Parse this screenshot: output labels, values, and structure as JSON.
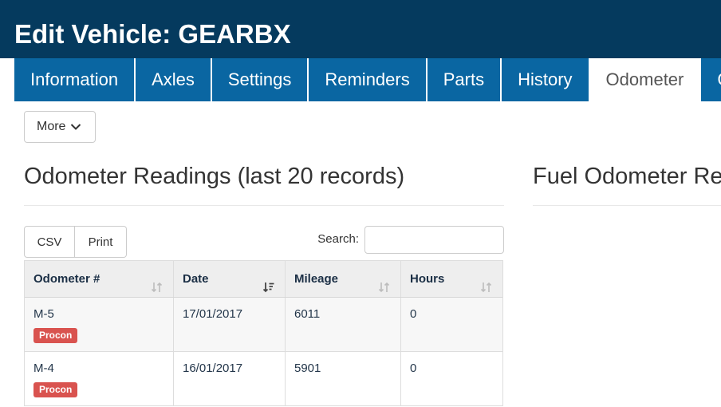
{
  "header": {
    "title": "Edit Vehicle: GEARBX"
  },
  "tabs": [
    {
      "label": "Information",
      "active": false
    },
    {
      "label": "Axles",
      "active": false
    },
    {
      "label": "Settings",
      "active": false
    },
    {
      "label": "Reminders",
      "active": false
    },
    {
      "label": "Parts",
      "active": false
    },
    {
      "label": "History",
      "active": false
    },
    {
      "label": "Odometer",
      "active": true
    },
    {
      "label": "C",
      "active": false
    }
  ],
  "toolbar": {
    "more_label": "More",
    "more_icon": "chevron-down-icon"
  },
  "odometer_panel": {
    "title": "Odometer Readings (last 20 records)",
    "export_buttons": {
      "csv_label": "CSV",
      "print_label": "Print"
    },
    "search": {
      "label": "Search:",
      "value": ""
    },
    "table": {
      "columns": [
        {
          "label": "Odometer #",
          "icon": "sort-both-icon"
        },
        {
          "label": "Date",
          "icon": "sort-desc-icon"
        },
        {
          "label": "Mileage",
          "icon": "sort-both-icon"
        },
        {
          "label": "Hours",
          "icon": "sort-both-icon"
        }
      ],
      "rows": [
        {
          "odometer": "M-5",
          "badge": "Procon",
          "date": "17/01/2017",
          "mileage": "6011",
          "hours": "0"
        },
        {
          "odometer": "M-4",
          "badge": "Procon",
          "date": "16/01/2017",
          "mileage": "5901",
          "hours": "0"
        }
      ]
    }
  },
  "fuel_panel": {
    "title": "Fuel Odometer Re"
  },
  "colors": {
    "header_bg": "#053a5e",
    "tab_bg": "#0a66a2",
    "badge_bg": "#d9534f"
  }
}
